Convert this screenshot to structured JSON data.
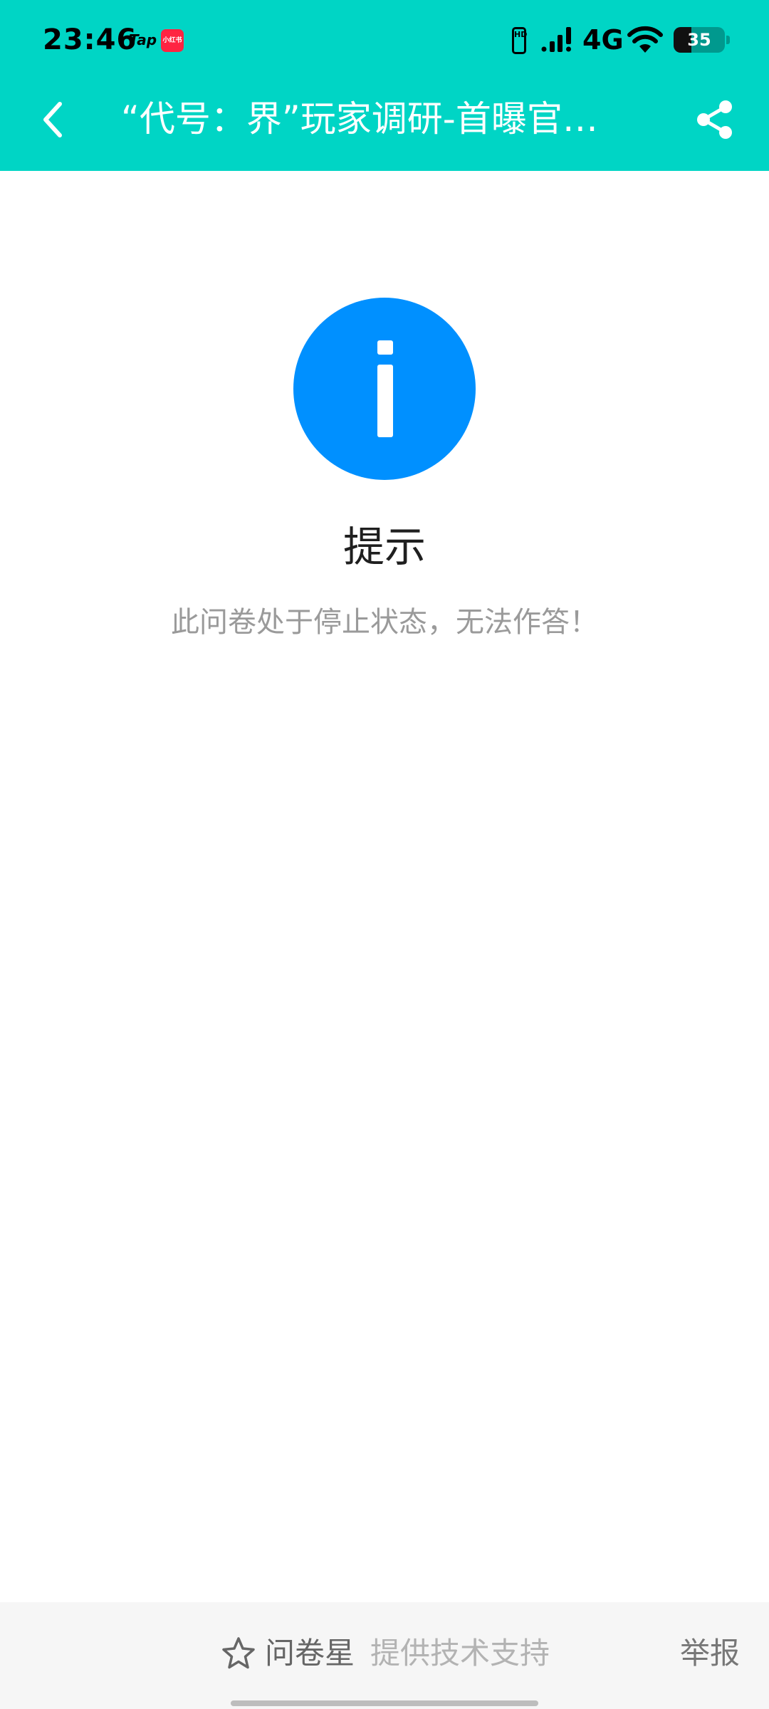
{
  "status_bar": {
    "time": "23:46",
    "tap_badge": "Tap",
    "xhs_badge": "小红书",
    "hd_label": "HD",
    "network": "4G",
    "battery_level": "35",
    "battery_fraction": 0.35
  },
  "header": {
    "title": "“代号：界”玩家调研-首曝官…",
    "back_icon": "chevron-left-icon",
    "share_icon": "share-icon",
    "color": "#00d5c5"
  },
  "notice": {
    "icon": "info-icon",
    "icon_color": "#0090ff",
    "title": "提示",
    "message": "此问卷处于停止状态，无法作答！"
  },
  "footer": {
    "brand_icon": "star-icon",
    "brand_name": "问卷星",
    "support_text": "提供技术支持",
    "report_label": "举报"
  }
}
